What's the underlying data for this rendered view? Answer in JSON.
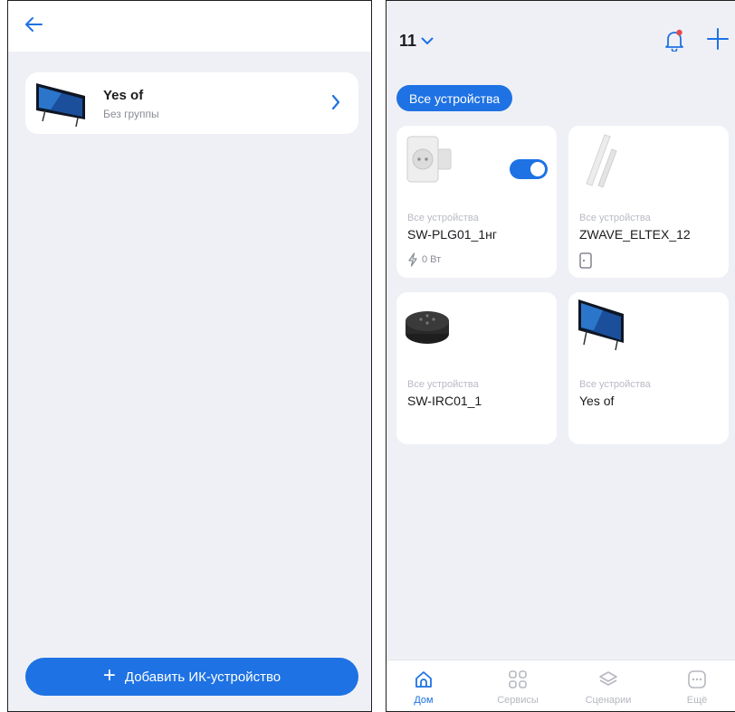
{
  "left": {
    "device": {
      "name": "Yes of",
      "group": "Без группы"
    },
    "add_ir_button": {
      "plus": "+",
      "label": "Добавить ИК-устройство"
    }
  },
  "right": {
    "home_selector": "11",
    "filter_chip": "Все устройства",
    "cards": [
      {
        "category": "Все устройства",
        "name": "SW-PLG01_1нг",
        "power": "0 Вт",
        "switch_on": true
      },
      {
        "category": "Все устройства",
        "name": "ZWAVE_ELTEX_12"
      },
      {
        "category": "Все устройства",
        "name": "SW-IRC01_1"
      },
      {
        "category": "Все устройства",
        "name": "Yes of"
      }
    ],
    "nav": [
      {
        "label": "Дом",
        "icon": "home-icon",
        "active": true
      },
      {
        "label": "Сервисы",
        "icon": "grid-icon",
        "active": false
      },
      {
        "label": "Сценарии",
        "icon": "layers-icon",
        "active": false
      },
      {
        "label": "Ещё",
        "icon": "more-icon",
        "active": false
      }
    ]
  },
  "colors": {
    "accent": "#1e72e3",
    "background": "#eff0f5",
    "card": "#ffffff",
    "notification_dot": "#e5484d"
  }
}
